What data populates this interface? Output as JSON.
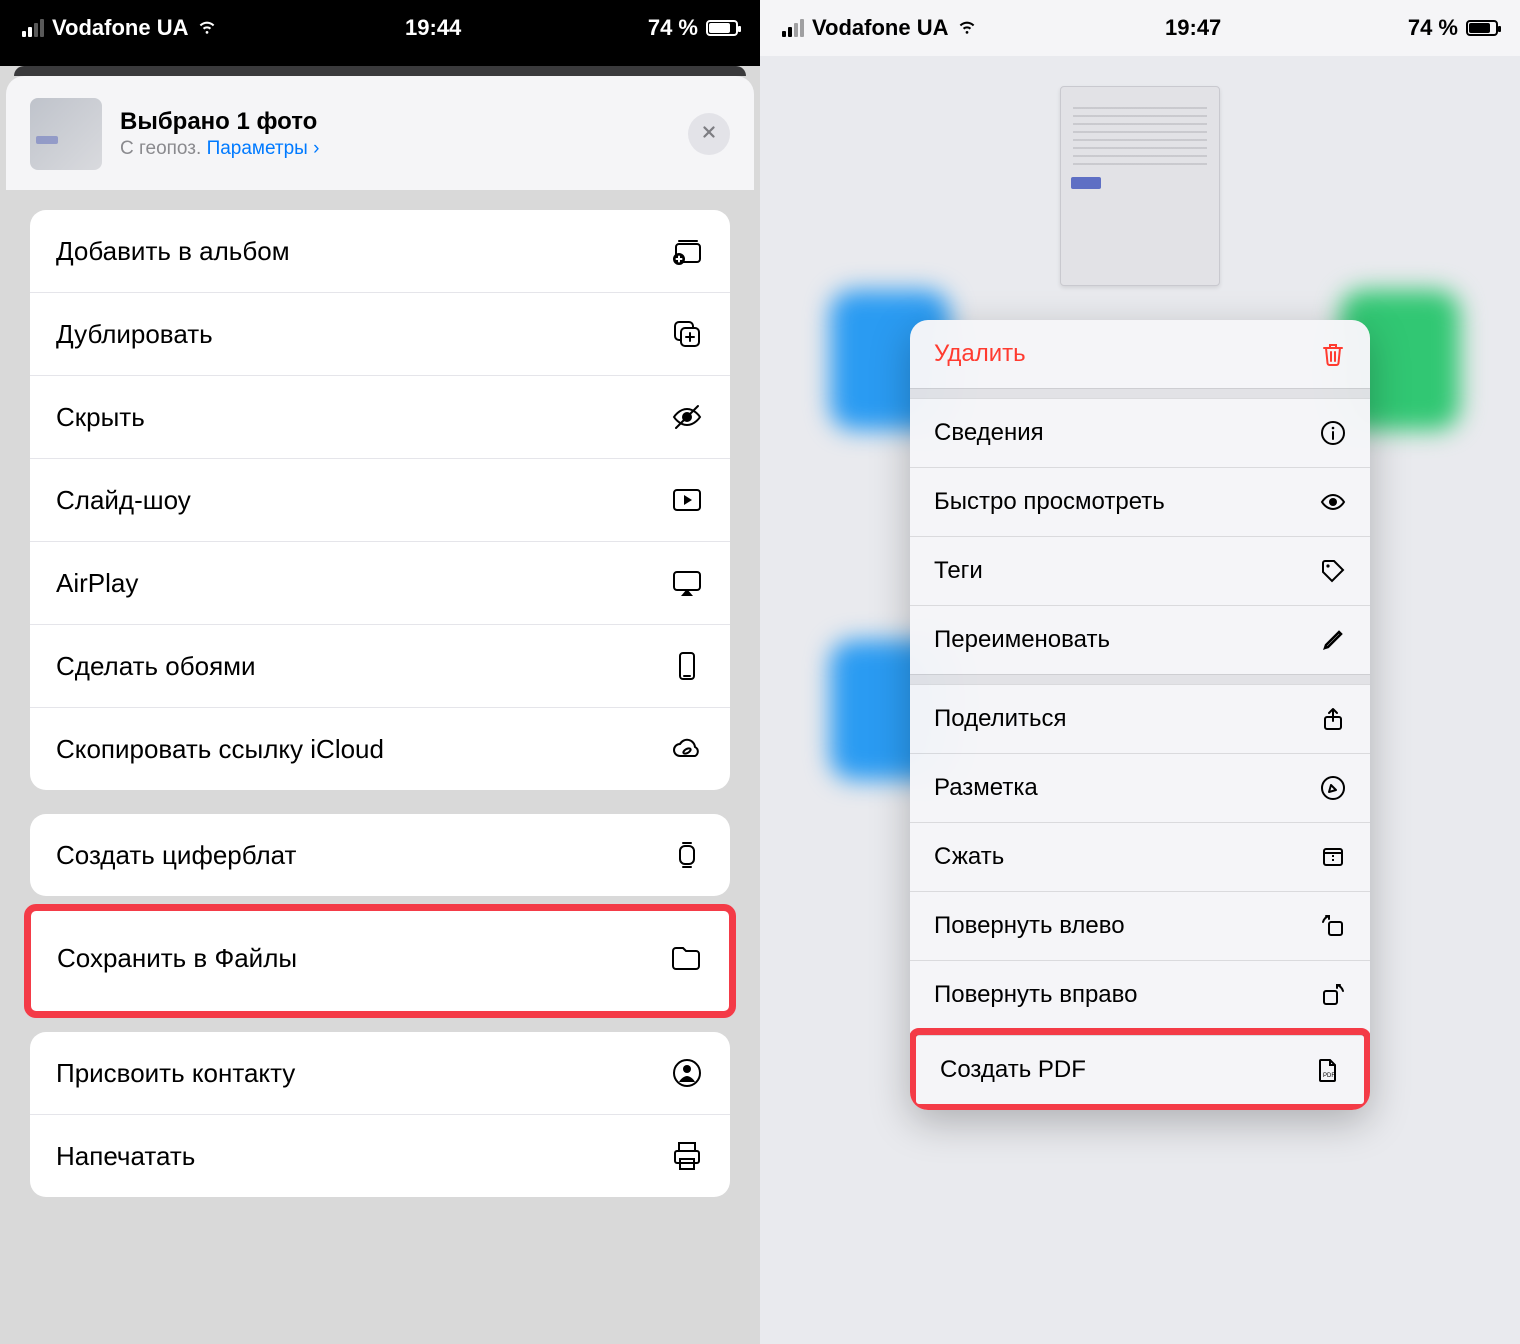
{
  "left": {
    "status": {
      "carrier": "Vodafone UA",
      "time": "19:44",
      "battery": "74 %"
    },
    "header": {
      "title": "Выбрано 1 фото",
      "sub_prefix": "С геопоз.  ",
      "params_link": "Параметры ›"
    },
    "group1": [
      {
        "label": "Добавить в альбом",
        "icon": "add-album-icon"
      },
      {
        "label": "Дублировать",
        "icon": "duplicate-icon"
      },
      {
        "label": "Скрыть",
        "icon": "hide-icon"
      },
      {
        "label": "Слайд-шоу",
        "icon": "slideshow-icon"
      },
      {
        "label": "AirPlay",
        "icon": "airplay-icon"
      },
      {
        "label": "Сделать обоями",
        "icon": "wallpaper-icon"
      },
      {
        "label": "Скопировать ссылку iCloud",
        "icon": "icloud-link-icon"
      }
    ],
    "group2_top": {
      "label": "Создать циферблат",
      "icon": "watchface-icon"
    },
    "highlight": {
      "label": "Сохранить в Файлы",
      "icon": "folder-icon"
    },
    "group2_rest": [
      {
        "label": "Присвоить контакту",
        "icon": "contact-icon"
      },
      {
        "label": "Напечатать",
        "icon": "print-icon"
      }
    ]
  },
  "right": {
    "status": {
      "carrier": "Vodafone UA",
      "time": "19:47",
      "battery": "74 %"
    },
    "menu": {
      "sec1": [
        {
          "label": "Удалить",
          "icon": "trash-icon",
          "danger": true
        }
      ],
      "sec2": [
        {
          "label": "Сведения",
          "icon": "info-icon"
        },
        {
          "label": "Быстро просмотреть",
          "icon": "quicklook-icon"
        },
        {
          "label": "Теги",
          "icon": "tag-icon"
        },
        {
          "label": "Переименовать",
          "icon": "rename-icon"
        }
      ],
      "sec3": [
        {
          "label": "Поделиться",
          "icon": "share-icon"
        },
        {
          "label": "Разметка",
          "icon": "markup-icon"
        },
        {
          "label": "Сжать",
          "icon": "compress-icon"
        },
        {
          "label": "Повернуть влево",
          "icon": "rotate-left-icon"
        },
        {
          "label": "Повернуть вправо",
          "icon": "rotate-right-icon"
        }
      ],
      "highlight": {
        "label": "Создать PDF",
        "icon": "pdf-icon"
      }
    }
  }
}
